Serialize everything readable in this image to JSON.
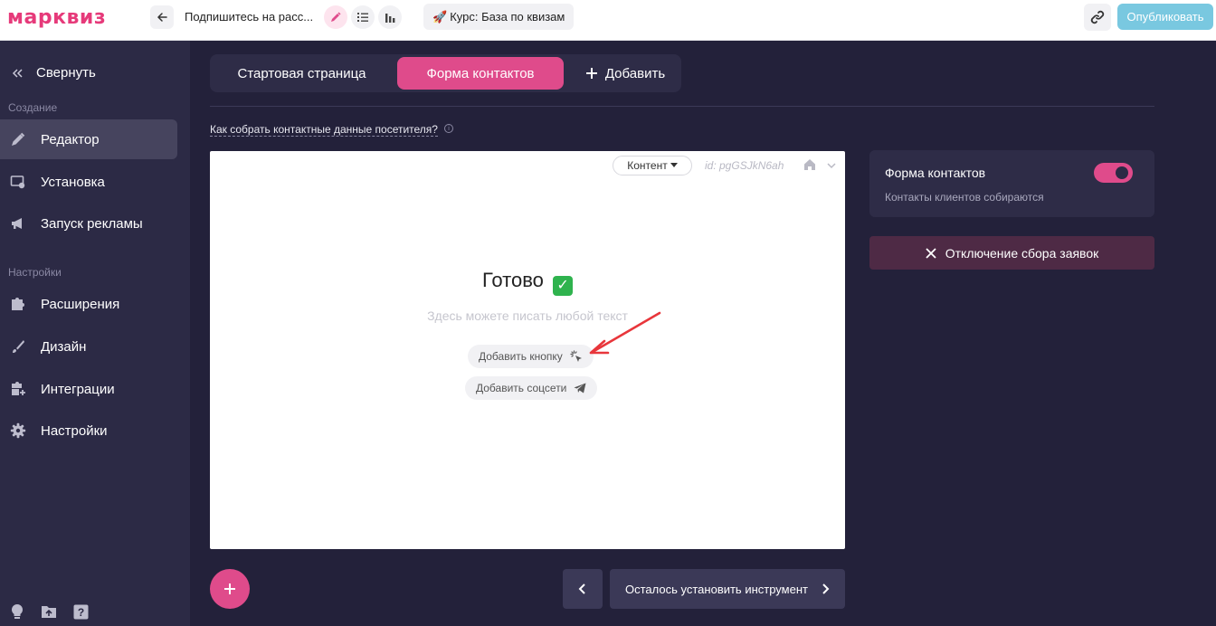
{
  "header": {
    "logo": "марквиз",
    "quiz_title": "Подпишитесь на расс...",
    "course_chip": {
      "emoji": "🚀",
      "label": "Курс: База по квизам"
    },
    "publish_label": "Опубликовать"
  },
  "sidebar": {
    "collapse_label": "Свернуть",
    "section_create": "Создание",
    "section_settings": "Настройки",
    "items": [
      {
        "label": "Редактор",
        "icon": "pencil-icon",
        "active": true
      },
      {
        "label": "Установка",
        "icon": "install-icon",
        "active": false
      },
      {
        "label": "Запуск рекламы",
        "icon": "megaphone-icon",
        "active": false
      },
      {
        "label": "Расширения",
        "icon": "puzzle-icon",
        "active": false
      },
      {
        "label": "Дизайн",
        "icon": "brush-icon",
        "active": false
      },
      {
        "label": "Интеграции",
        "icon": "integrations-icon",
        "active": false
      },
      {
        "label": "Настройки",
        "icon": "gear-icon",
        "active": false
      }
    ],
    "bottom_icons": [
      "lightbulb-icon",
      "folder-upload-icon",
      "help-icon"
    ]
  },
  "main": {
    "tabs": [
      {
        "label": "Стартовая страница",
        "active": false
      },
      {
        "label": "Форма контактов",
        "active": true
      }
    ],
    "add_tab_label": "Добавить",
    "help_link": "Как собрать контактные данные посетителя?",
    "canvas": {
      "content_dropdown": "Контент",
      "page_id": "id: pgGSJkN6ah",
      "title": "Готово",
      "title_emoji": "✓",
      "description": "Здесь можете писать любой текст",
      "add_button_label": "Добавить кнопку",
      "add_social_label": "Добавить соцсети"
    },
    "contact_card": {
      "title": "Форма контактов",
      "subtitle": "Контакты клиентов собираются",
      "toggle_on": true
    },
    "disable_button": "Отключение сбора заявок",
    "next_button": "Осталось установить инструмент"
  },
  "colors": {
    "brand_pink": "#df4b8b",
    "sidebar_bg": "#2c2a45",
    "main_bg": "#23213a",
    "publish_blue": "#79c8e0",
    "annotation_red": "#e8363b"
  }
}
